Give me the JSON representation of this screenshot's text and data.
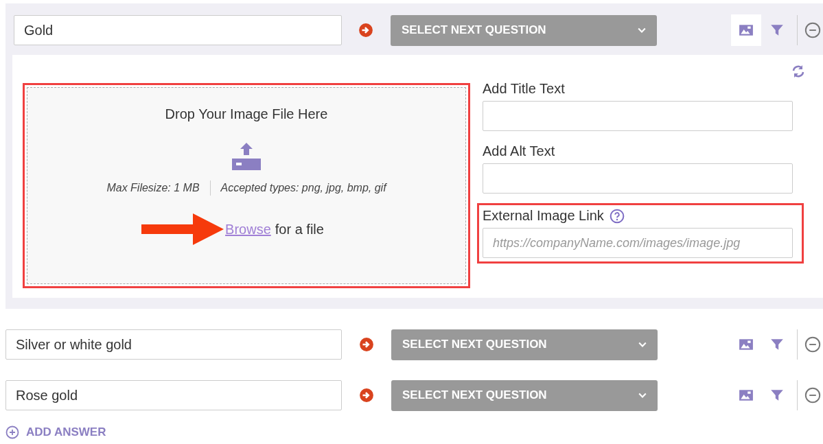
{
  "answers": [
    {
      "value": "Gold",
      "dropdown": "SELECT NEXT QUESTION",
      "expanded": true,
      "image_panel": {
        "drop_title": "Drop Your Image File Here",
        "max_size": "Max Filesize: 1 MB",
        "types": "Accepted types: png, jpg, bmp, gif",
        "browse_link": "Browse",
        "browse_rest": "for a file",
        "title_label": "Add Title Text",
        "alt_label": "Add Alt Text",
        "link_label": "External Image Link",
        "link_placeholder": "https://companyName.com/images/image.jpg"
      }
    },
    {
      "value": "Silver or white gold",
      "dropdown": "SELECT NEXT QUESTION",
      "expanded": false
    },
    {
      "value": "Rose gold",
      "dropdown": "SELECT NEXT QUESTION",
      "expanded": false
    }
  ],
  "add_answer": "ADD ANSWER"
}
